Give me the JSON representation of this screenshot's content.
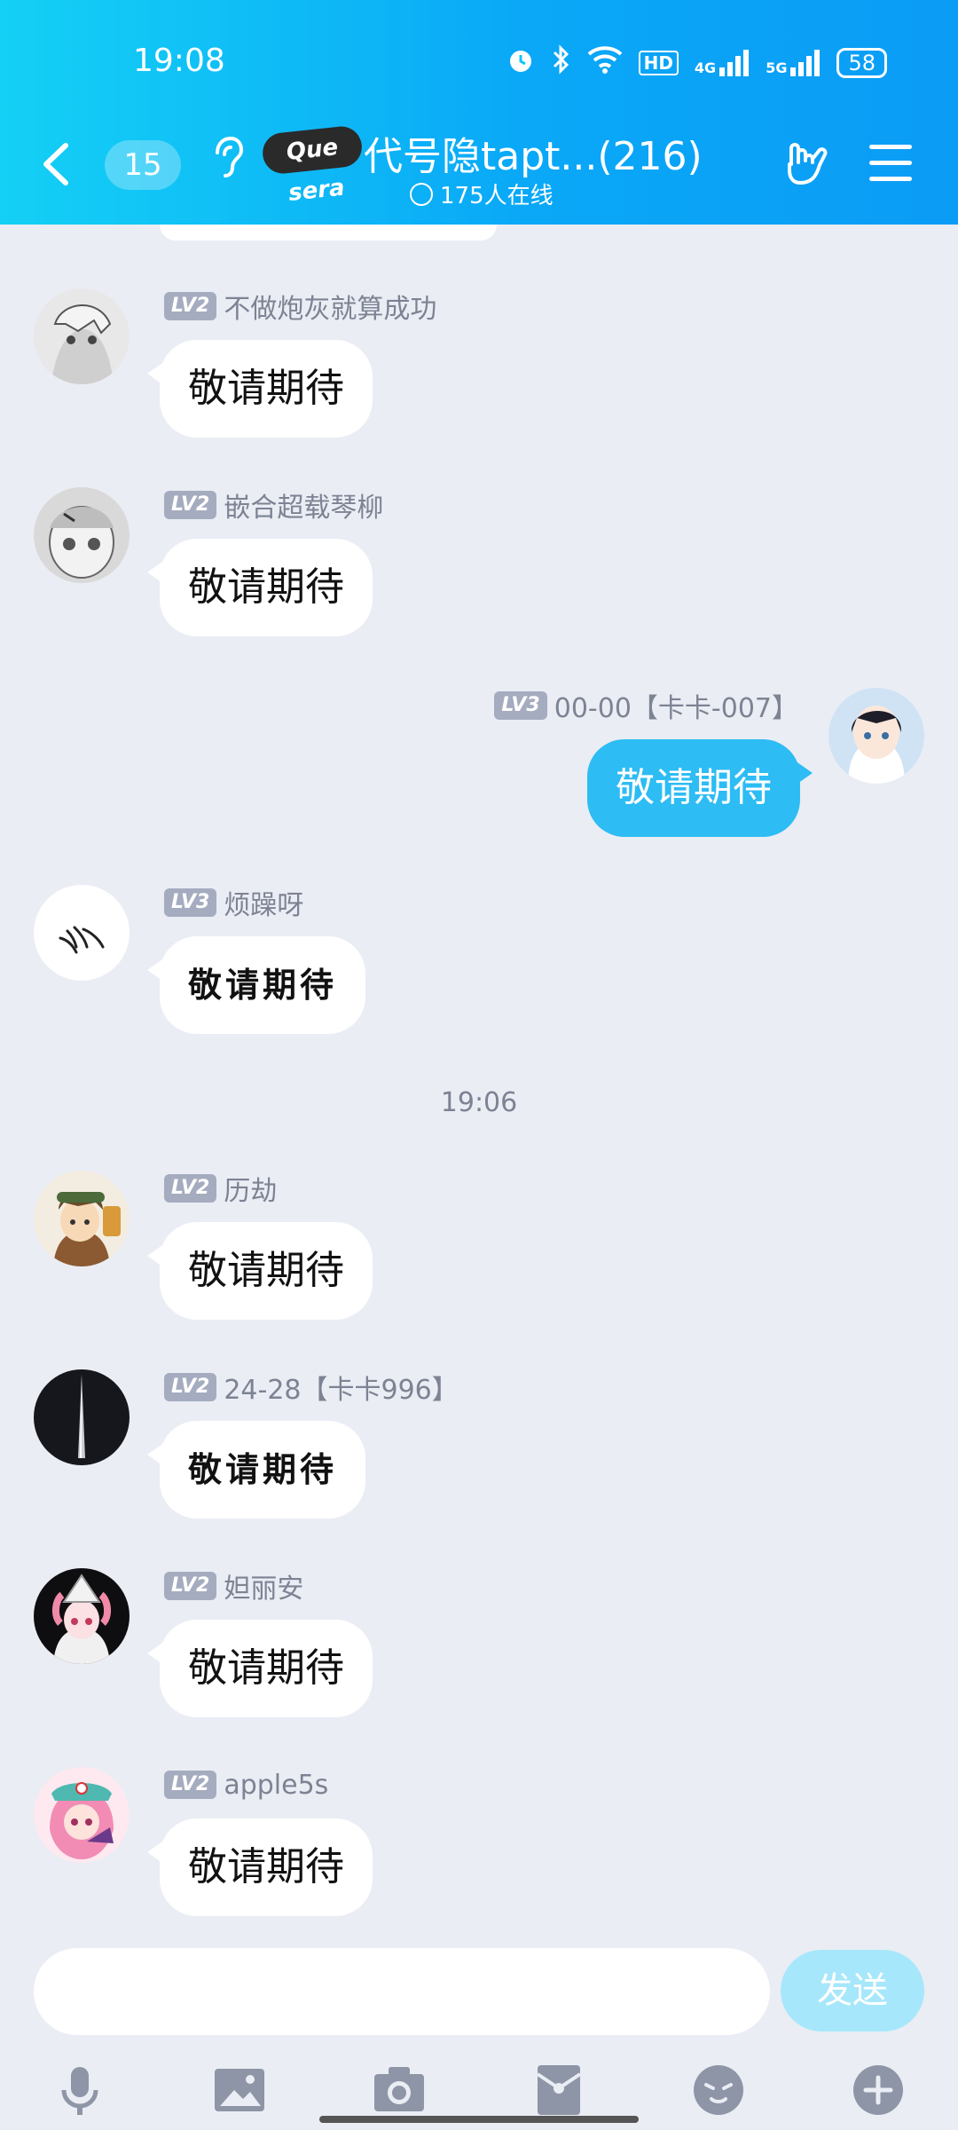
{
  "status_bar": {
    "time": "19:08",
    "battery": "58",
    "network1": "4G",
    "network2": "5G",
    "hd_label": "HD"
  },
  "header": {
    "unread_count": "15",
    "logo_text": "Que sera",
    "title": "代号隐tapt...(216)",
    "online_text": "175人在线"
  },
  "messages": [
    {
      "level": "LV2",
      "name": "不做炮灰就算成功",
      "text": "敬请期待",
      "mine": false
    },
    {
      "level": "LV2",
      "name": "嵌合超载琴柳",
      "text": "敬请期待",
      "mine": false
    },
    {
      "level": "LV3",
      "name": "00-00【卡卡-007】",
      "text": "敬请期待",
      "mine": true
    },
    {
      "level": "LV3",
      "name": "烦躁呀",
      "text": "敬请期待",
      "mine": false
    },
    {
      "level": "LV2",
      "name": "历劫",
      "text": "敬请期待",
      "mine": false
    },
    {
      "level": "LV2",
      "name": "24-28【卡卡996】",
      "text": "敬请期待",
      "mine": false
    },
    {
      "level": "LV2",
      "name": "妲丽安",
      "text": "敬请期待",
      "mine": false
    },
    {
      "level": "LV2",
      "name": "apple5s",
      "text": "敬请期待",
      "mine": false
    }
  ],
  "time_separator": "19:06",
  "input": {
    "placeholder": "",
    "send_label": "发送"
  },
  "toolbar_icons": [
    "microphone-icon",
    "image-icon",
    "camera-icon",
    "red-packet-icon",
    "emoji-icon",
    "plus-icon"
  ]
}
